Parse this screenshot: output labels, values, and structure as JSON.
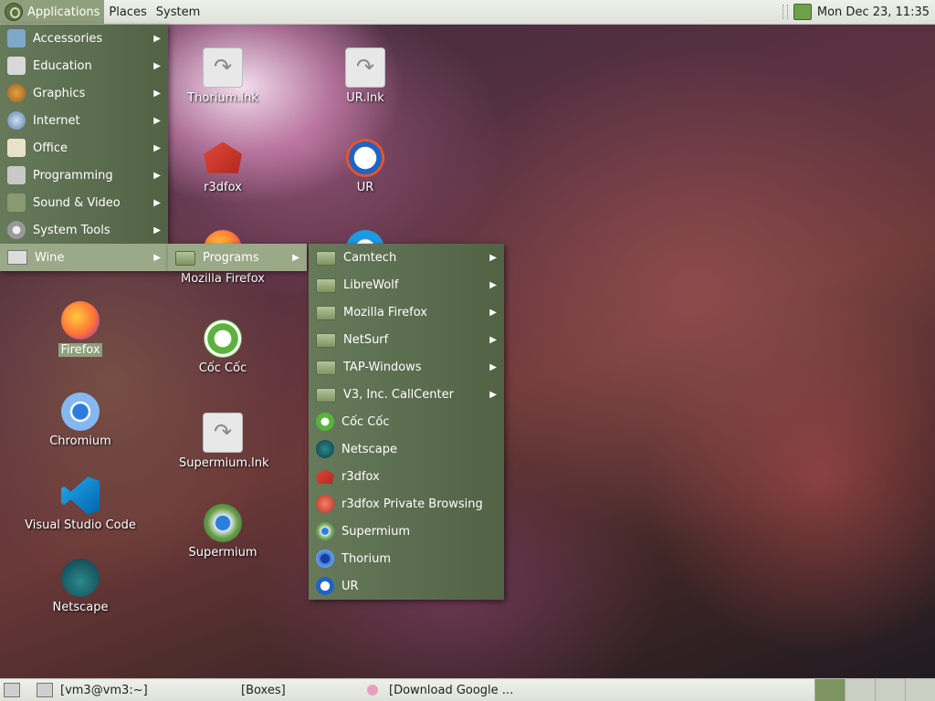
{
  "top_panel": {
    "menus": [
      "Applications",
      "Places",
      "System"
    ],
    "clock": "Mon Dec 23, 11:35"
  },
  "desktop_icons": [
    {
      "label": "Thorium.lnk",
      "icon": "shortcut-icon"
    },
    {
      "label": "UR.lnk",
      "icon": "shortcut-icon"
    },
    {
      "label": "r3dfox",
      "icon": "r3dfox-icon"
    },
    {
      "label": "UR",
      "icon": "ur-browser-icon"
    },
    {
      "label": "Mozilla Firefox",
      "icon": "firefox-icon"
    },
    {
      "label": "Firefox",
      "icon": "firefox-icon"
    },
    {
      "label": "Cốc Cốc",
      "icon": "coccoc-icon"
    },
    {
      "label": "Chromium",
      "icon": "chromium-icon"
    },
    {
      "label": "Supermium.lnk",
      "icon": "shortcut-icon"
    },
    {
      "label": "Visual Studio Code",
      "icon": "vscode-icon"
    },
    {
      "label": "Supermium",
      "icon": "supermium-icon"
    },
    {
      "label": "Netscape",
      "icon": "netscape-icon"
    }
  ],
  "applications_menu": {
    "items": [
      "Accessories",
      "Education",
      "Graphics",
      "Internet",
      "Office",
      "Programming",
      "Sound & Video",
      "System Tools",
      "Wine"
    ]
  },
  "wine_menu": {
    "items": [
      "Programs"
    ]
  },
  "programs_menu": {
    "folders": [
      "Camtech",
      "LibreWolf",
      "Mozilla Firefox",
      "NetSurf",
      "TAP-Windows",
      "V3, Inc. CallCenter"
    ],
    "apps": [
      "Cốc Cốc",
      "Netscape",
      "r3dfox",
      "r3dfox Private Browsing",
      "Supermium",
      "Thorium",
      "UR"
    ]
  },
  "bottom_panel": {
    "tasks": [
      "[vm3@vm3:~]",
      "[Boxes]",
      "[Download Google ..."
    ]
  },
  "colors": {
    "menu_bg": "#5a6b4e",
    "highlight": "#9aaa88",
    "accent": "#7d9460"
  }
}
